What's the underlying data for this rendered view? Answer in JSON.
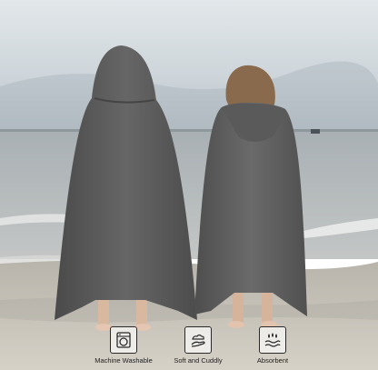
{
  "features": [
    {
      "icon": "washing-machine-icon",
      "label": "Machine Washable"
    },
    {
      "icon": "hand-cloud-icon",
      "label": "Soft and Cuddly"
    },
    {
      "icon": "water-drops-icon",
      "label": "Absorbent"
    }
  ],
  "colors": {
    "sky": "#cfd6db",
    "sea": "#b9bfc2",
    "sand": "#c9c2b6",
    "towel": "#5d5d5d",
    "icon_stroke": "#2a2a2a"
  }
}
